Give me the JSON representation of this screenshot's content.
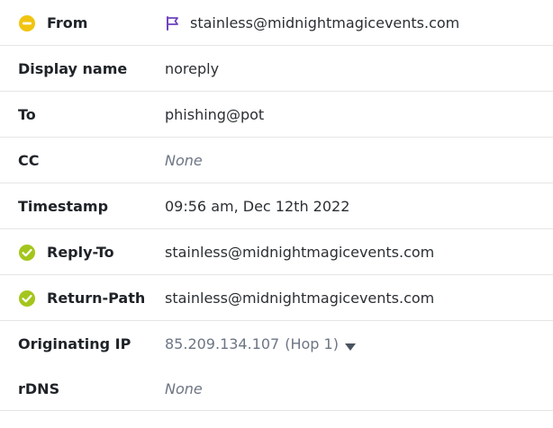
{
  "rows": {
    "from": {
      "label": "From",
      "value": "stainless@midnightmagicevents.com",
      "status_icon": "warning-icon",
      "flag_icon": "flag-icon",
      "status_color": "#f1c40f",
      "flag_color": "#6f42c1"
    },
    "display_name": {
      "label": "Display name",
      "value": "noreply"
    },
    "to": {
      "label": "To",
      "value": "phishing@pot"
    },
    "cc": {
      "label": "CC",
      "value": "None"
    },
    "timestamp": {
      "label": "Timestamp",
      "value": "09:56 am, Dec 12th 2022"
    },
    "reply_to": {
      "label": "Reply-To",
      "value": "stainless@midnightmagicevents.com",
      "status_icon": "check-circle-icon",
      "status_color": "#a4c61c"
    },
    "return_path": {
      "label": "Return-Path",
      "value": "stainless@midnightmagicevents.com",
      "status_icon": "check-circle-icon",
      "status_color": "#a4c61c"
    },
    "originating_ip": {
      "label": "Originating IP",
      "value": "85.209.134.107",
      "hop": "(Hop 1)",
      "toggle_icon": "caret-down-icon"
    },
    "rdns": {
      "label": "rDNS",
      "value": "None"
    }
  }
}
